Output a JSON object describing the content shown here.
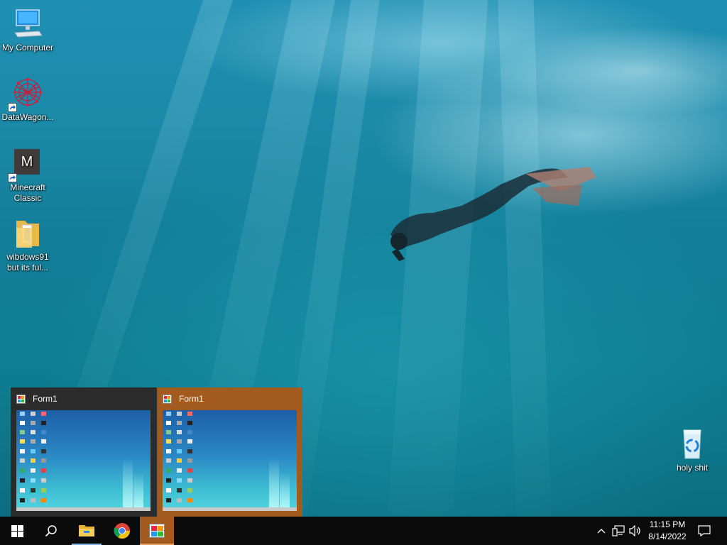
{
  "desktop": {
    "icons": [
      {
        "label": "My Computer",
        "icon": "computer-icon"
      },
      {
        "label": "DataWagon...",
        "icon": "datawagon-icon"
      },
      {
        "label": "Minecraft Classic",
        "icon": "minecraft-icon",
        "glyph_letter": "M"
      },
      {
        "label": "wibdows91 but its ful...",
        "icon": "folder-icon"
      },
      {
        "label": "holy shit",
        "icon": "recycle-bin-icon"
      }
    ]
  },
  "previews": [
    {
      "title": "Form1",
      "state": "inactive"
    },
    {
      "title": "Form1",
      "state": "active"
    }
  ],
  "taskbar": {
    "start": "windows-start-icon",
    "search": "search-icon",
    "pinned": [
      "file-explorer-icon",
      "chrome-icon",
      "form1-app-icon"
    ],
    "tray": [
      "chevron-up-icon",
      "network-icon",
      "volume-icon"
    ],
    "clock": {
      "time": "11:15 PM",
      "date": "8/14/2022"
    },
    "notifications": "action-center-icon"
  },
  "colors": {
    "taskbar": "#0b0b0b",
    "active_accent": "#a35a1f",
    "preview_bg": "#2b2b2b"
  }
}
